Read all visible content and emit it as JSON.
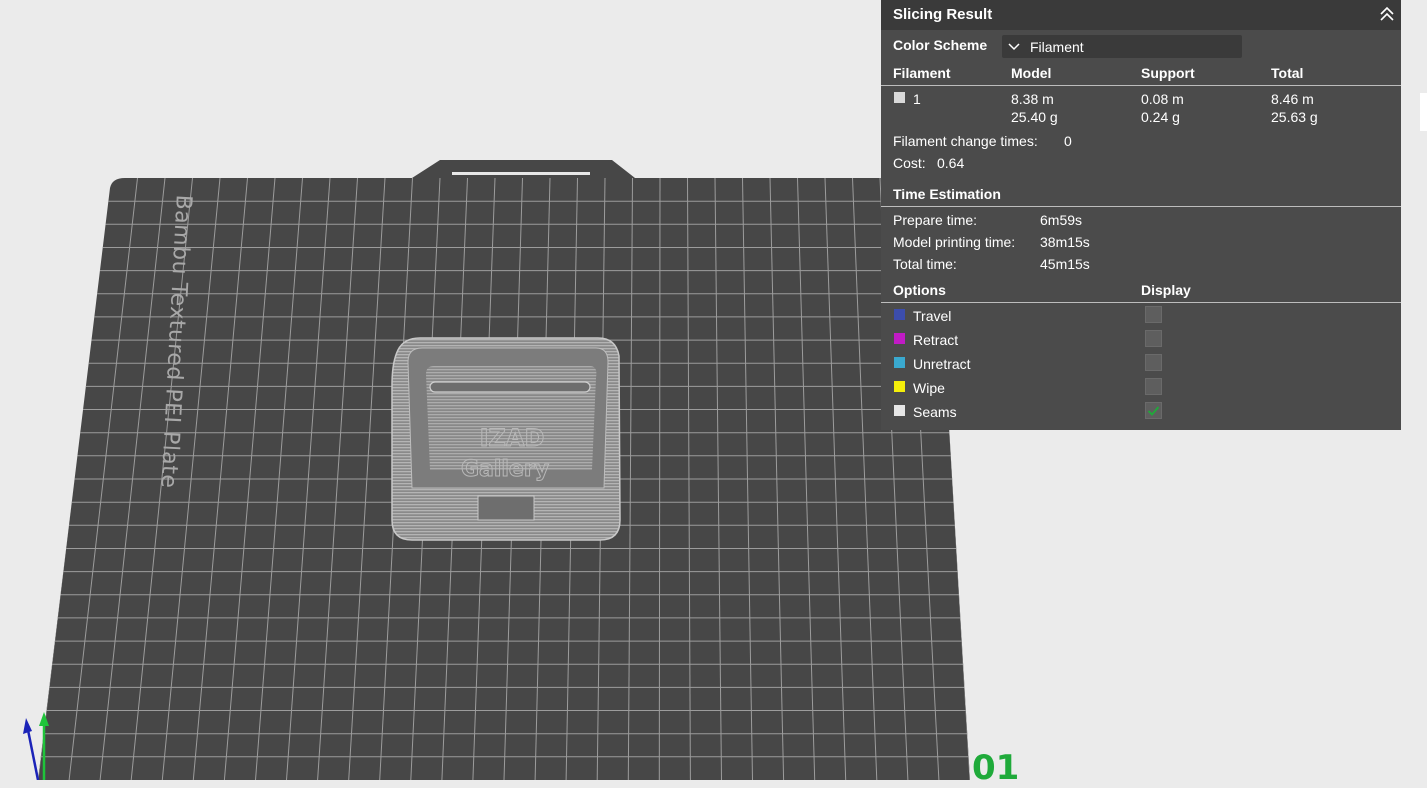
{
  "viewport": {
    "plate_label": "Bambu Textured PEI Plate",
    "plate_number": "01"
  },
  "panel": {
    "title": "Slicing Result",
    "color_scheme": {
      "label": "Color Scheme",
      "value": "Filament"
    },
    "filament_table": {
      "headers": [
        "Filament",
        "Model",
        "Support",
        "Total"
      ],
      "rows": [
        {
          "filament": "1",
          "color": "#d9d9d9",
          "model_length": "8.38 m",
          "model_weight": "25.40 g",
          "support_length": "0.08 m",
          "support_weight": "0.24 g",
          "total_length": "8.46 m",
          "total_weight": "25.63 g"
        }
      ]
    },
    "change_times": {
      "label": "Filament change times:",
      "value": "0"
    },
    "cost": {
      "label": "Cost:",
      "value": "0.64"
    },
    "time_estimation": {
      "heading": "Time Estimation",
      "prepare": {
        "label": "Prepare time:",
        "value": "6m59s"
      },
      "printing": {
        "label": "Model printing time:",
        "value": "38m15s"
      },
      "total": {
        "label": "Total time:",
        "value": "45m15s"
      }
    },
    "options": {
      "headers": [
        "Options",
        "Display"
      ],
      "items": [
        {
          "label": "Travel",
          "color": "#3c4dac",
          "checked": false
        },
        {
          "label": "Retract",
          "color": "#c11bc5",
          "checked": false
        },
        {
          "label": "Unretract",
          "color": "#3aa9cf",
          "checked": false
        },
        {
          "label": "Wipe",
          "color": "#f4ee0a",
          "checked": false
        },
        {
          "label": "Seams",
          "color": "#e6e6e6",
          "checked": true
        }
      ]
    },
    "colors": {
      "panel_bg": "#4b4b4b",
      "title_bg": "#3a3a3a",
      "check": "#1faa3a"
    }
  }
}
